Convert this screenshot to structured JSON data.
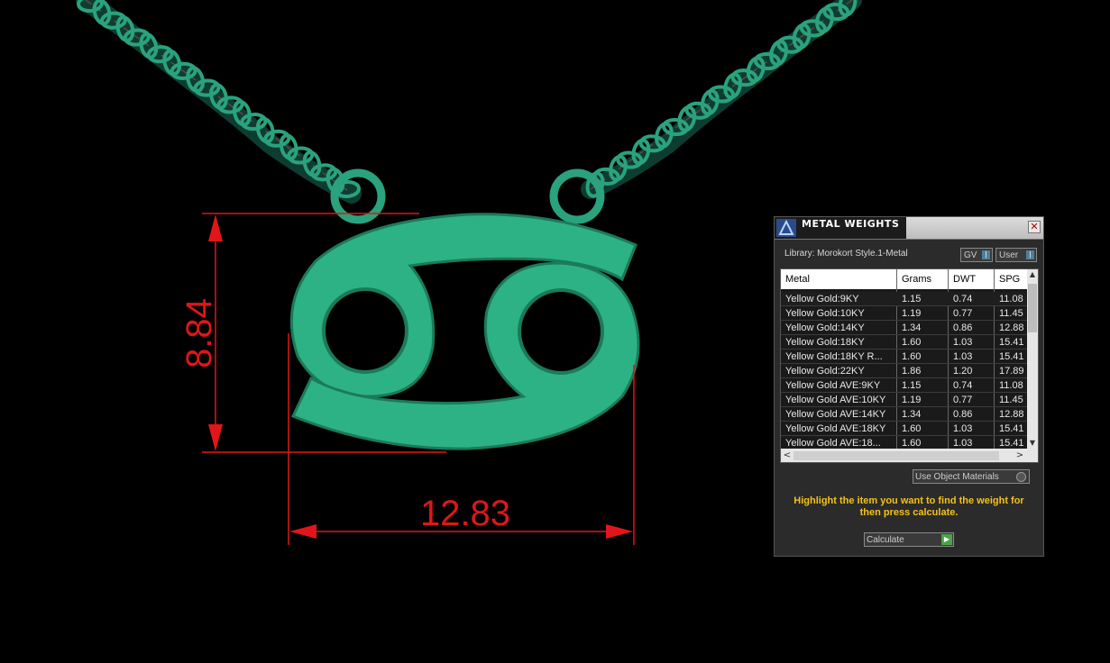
{
  "viewport": {
    "dimension_height": "8.84",
    "dimension_width": "12.83",
    "model_color": "#2db285",
    "dimension_color": "#e0161a"
  },
  "panel": {
    "title": "METAL WEIGHTS",
    "close_label": "✕",
    "library_label": "Library: Morokort Style.1-Metal",
    "toggle_gv": "GV",
    "toggle_user": "User",
    "columns": [
      "Metal",
      "Grams",
      "DWT",
      "SPG"
    ],
    "rows": [
      {
        "metal": "Yellow Gold:9KY",
        "grams": "1.15",
        "dwt": "0.74",
        "spg": "11.08"
      },
      {
        "metal": "Yellow Gold:10KY",
        "grams": "1.19",
        "dwt": "0.77",
        "spg": "11.45"
      },
      {
        "metal": "Yellow Gold:14KY",
        "grams": "1.34",
        "dwt": "0.86",
        "spg": "12.88"
      },
      {
        "metal": "Yellow Gold:18KY",
        "grams": "1.60",
        "dwt": "1.03",
        "spg": "15.41"
      },
      {
        "metal": "Yellow Gold:18KY R...",
        "grams": "1.60",
        "dwt": "1.03",
        "spg": "15.41"
      },
      {
        "metal": "Yellow Gold:22KY",
        "grams": "1.86",
        "dwt": "1.20",
        "spg": "17.89"
      },
      {
        "metal": "Yellow Gold AVE:9KY",
        "grams": "1.15",
        "dwt": "0.74",
        "spg": "11.08"
      },
      {
        "metal": "Yellow Gold AVE:10KY",
        "grams": "1.19",
        "dwt": "0.77",
        "spg": "11.45"
      },
      {
        "metal": "Yellow Gold AVE:14KY",
        "grams": "1.34",
        "dwt": "0.86",
        "spg": "12.88"
      },
      {
        "metal": "Yellow Gold AVE:18KY",
        "grams": "1.60",
        "dwt": "1.03",
        "spg": "15.41"
      },
      {
        "metal": "Yellow Gold AVE:18...",
        "grams": "1.60",
        "dwt": "1.03",
        "spg": "15.41"
      }
    ],
    "use_materials_label": "Use Object Materials",
    "hint": "Highlight the item you want to find the weight for then press calculate.",
    "calculate_label": "Calculate",
    "accent_color": "#f2c21a"
  }
}
